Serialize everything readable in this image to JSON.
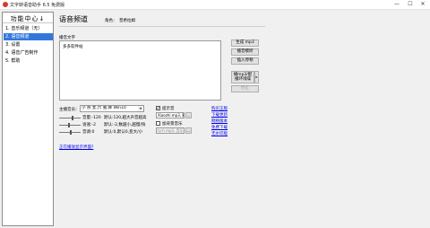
{
  "window": {
    "title": "文字转语音助手 6.5 免费版",
    "controls": [
      "—",
      "☐",
      "✕"
    ]
  },
  "sidebar": {
    "header": "功能中心↓",
    "items": [
      {
        "label": "1. 音乐频道（无）",
        "selected": false
      },
      {
        "label": "2. 语音频道",
        "selected": true
      },
      {
        "label": "3. 设置",
        "selected": false
      },
      {
        "label": "4. 语音广告制作",
        "selected": false
      },
      {
        "label": "5. 帮助",
        "selected": false
      }
    ]
  },
  "main": {
    "title": "语音频道",
    "voice_label": "角色：",
    "voice_value": "普希拉姆"
  },
  "editor": {
    "label": "播音文字",
    "text": "多多软件站"
  },
  "buttons": {
    "generate_mp3": "生成 mp3",
    "play_audition": "播音模听",
    "insert_pause": "插入停顿",
    "play_mp3_music": "播mp3/配\n播环境噪",
    "dropdown_arrow": "▸",
    "stop": "停止"
  },
  "anchor": {
    "label": "主播音员：",
    "selected": "小 燕  女,六 重,降 Win10",
    "arrow": "▾"
  },
  "params": [
    {
      "name": "音量:-120",
      "desc": "默认:120,越大声音越高"
    },
    {
      "name": "语速:-2",
      "desc": "默认:-2,数越小,越慢/快"
    },
    {
      "name": "音调:0",
      "desc": "默认:0,默认0,变大/小"
    }
  ],
  "options": {
    "prompt_sound_label": "提示音",
    "prompt_sound_checked": "✔",
    "prompt_sound_file": "Xiaozhi.mp3, 默",
    "bg_music_label": "加背景音乐",
    "bg_music_checked": "",
    "bg_music_file": "ty-h.mp3, 音乐",
    "browse": "…",
    "vol_label": "音乐"
  },
  "links": {
    "right": [
      "购买正版",
      "下载更新",
      "网络版本",
      "免费下载",
      "无水印版"
    ],
    "bottom": "正在播放显示界面?"
  },
  "colors": {
    "selection": "#3377dd",
    "link": "#0000ee"
  }
}
